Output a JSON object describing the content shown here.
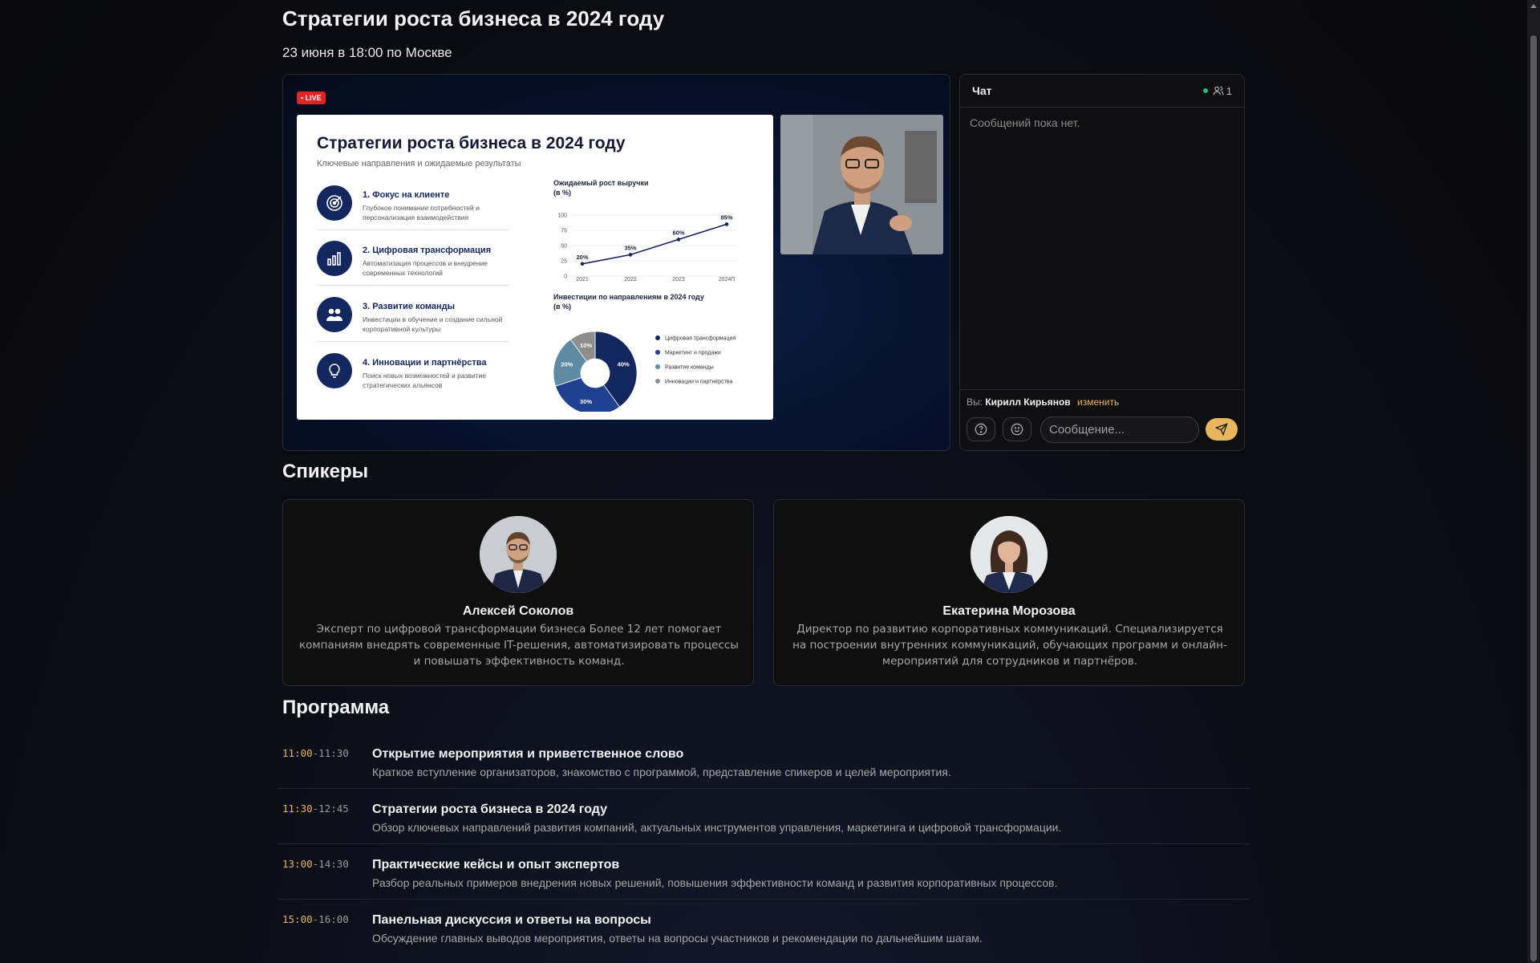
{
  "page": {
    "title": "Стратегии роста бизнеса в 2024 году",
    "date": "23 июня в 18:00 по Москве"
  },
  "player": {
    "live_badge": "• LIVE",
    "slide": {
      "title": "Стратегии роста бизнеса в 2024 году",
      "subtitle": "Ключевые направления и ожидаемые результаты",
      "items": [
        {
          "title": "1. Фокус на клиенте",
          "desc": "Глубокое понимание потребностей и персонализация взаимодействия",
          "icon": "target-icon"
        },
        {
          "title": "2. Цифровая трансформация",
          "desc": "Автоматизация процессов и внедрение современных технологий",
          "icon": "bar-chart-icon"
        },
        {
          "title": "3. Развитие команды",
          "desc": "Инвестиции в обучение и создание сильной корпоративной культуры",
          "icon": "team-icon"
        },
        {
          "title": "4. Инновации и партнёрства",
          "desc": "Поиск новых возможностей и развитие стратегических альянсов",
          "icon": "lightbulb-icon"
        }
      ]
    }
  },
  "chart_data": [
    {
      "type": "line",
      "title": "Ожидаемый рост выручки (в %)",
      "categories": [
        "2021",
        "2022",
        "2023",
        "2024П"
      ],
      "values": [
        20,
        35,
        60,
        85
      ],
      "data_labels": [
        "20%",
        "35%",
        "60%",
        "85%"
      ],
      "ylim": [
        0,
        100
      ],
      "yticks": [
        "0",
        "25",
        "50",
        "75",
        "100"
      ],
      "color": "#13275e"
    },
    {
      "type": "pie",
      "title": "Инвестиции по направлениям в 2024 году (в %)",
      "categories": [
        "Цифровая трансформация",
        "Маркетинг и продажи",
        "Развитие команды",
        "Инновации и партнёрства"
      ],
      "values": [
        40,
        30,
        20,
        10
      ],
      "data_labels": [
        "40%",
        "30%",
        "20%",
        "10%"
      ],
      "colors": [
        "#13275e",
        "#21408f",
        "#5f8aa3",
        "#8e8e8e"
      ]
    }
  ],
  "chat": {
    "title": "Чат",
    "user_count": "1",
    "empty": "Сообщений пока нет.",
    "me_prefix": "Вы:",
    "me_name": "Кирилл Кирьянов",
    "change": "изменить",
    "placeholder": "Сообщение...",
    "icons": {
      "help": "question-icon",
      "emoji": "smile-icon",
      "send": "send-icon",
      "users": "users-icon"
    }
  },
  "speakers": {
    "heading": "Спикеры",
    "items": [
      {
        "name": "Алексей Соколов",
        "bio": "Эксперт по цифровой трансформации бизнеса Более 12 лет помогает компаниям внедрять современные IT-решения, автоматизировать процессы и повышать эффективность команд."
      },
      {
        "name": "Екатерина Морозова",
        "bio": "Директор по развитию корпоративных коммуникаций. Специализируется на построении внутренних коммуникаций, обучающих программ и онлайн-мероприятий для сотрудников и партнёров."
      }
    ]
  },
  "program": {
    "heading": "Программа",
    "items": [
      {
        "start": "11:00",
        "end": "-11:30",
        "title": "Открытие мероприятия и приветственное слово",
        "desc": "Краткое вступление организаторов, знакомство с программой, представление спикеров и целей мероприятия."
      },
      {
        "start": "11:30",
        "end": "-12:45",
        "title": "Стратегии роста бизнеса в 2024 году",
        "desc": "Обзор ключевых направлений развития компаний, актуальных инструментов управления, маркетинга и цифровой трансформации."
      },
      {
        "start": "13:00",
        "end": "-14:30",
        "title": "Практические кейсы и опыт экспертов",
        "desc": "Разбор реальных примеров внедрения новых решений, повышения эффективности команд и развития корпоративных процессов."
      },
      {
        "start": "15:00",
        "end": "-16:00",
        "title": "Панельная дискуссия и ответы на вопросы",
        "desc": "Обсуждение главных выводов мероприятия, ответы на вопросы участников и рекомендации по дальнейшим шагам."
      }
    ]
  }
}
